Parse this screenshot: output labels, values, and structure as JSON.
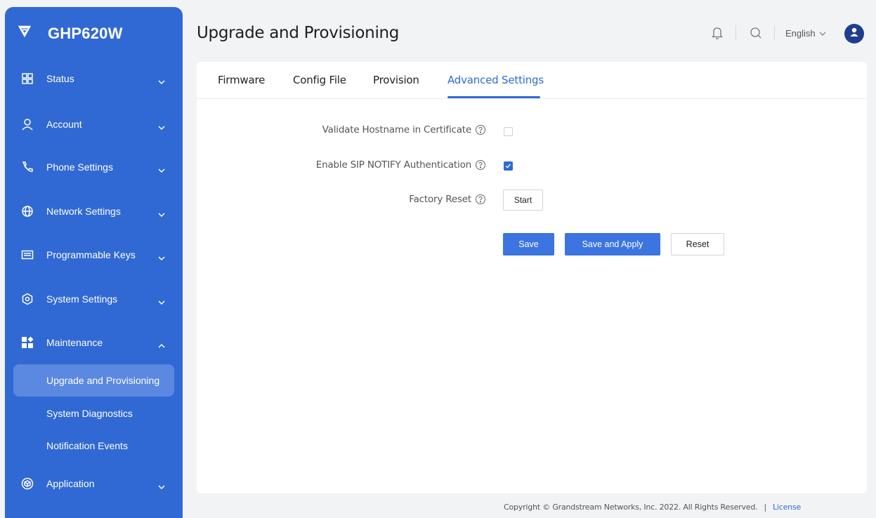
{
  "brand": {
    "name": "GHP620W"
  },
  "sidebar": {
    "items": [
      {
        "label": "Status"
      },
      {
        "label": "Account"
      },
      {
        "label": "Phone Settings"
      },
      {
        "label": "Network Settings"
      },
      {
        "label": "Programmable Keys"
      },
      {
        "label": "System Settings"
      },
      {
        "label": "Maintenance"
      },
      {
        "label": "Application"
      }
    ],
    "sub_items": [
      {
        "label": "Upgrade and Provisioning"
      },
      {
        "label": "System Diagnostics"
      },
      {
        "label": "Notification Events"
      }
    ]
  },
  "header": {
    "title": "Upgrade and Provisioning",
    "language": "English"
  },
  "tabs": [
    {
      "label": "Firmware"
    },
    {
      "label": "Config File"
    },
    {
      "label": "Provision"
    },
    {
      "label": "Advanced Settings"
    }
  ],
  "form": {
    "validate_hostname_label": "Validate Hostname in Certificate",
    "validate_hostname_checked": false,
    "sip_notify_label": "Enable SIP NOTIFY Authentication",
    "sip_notify_checked": true,
    "factory_reset_label": "Factory Reset",
    "start_label": "Start",
    "save_label": "Save",
    "save_apply_label": "Save and Apply",
    "reset_label": "Reset"
  },
  "footer": {
    "copyright": "Copyright © Grandstream Networks, Inc. 2022. All Rights Reserved.",
    "separator": "|",
    "license": "License"
  },
  "colors": {
    "accent": "#3169d4",
    "sidebar_bg": "#3169d4",
    "sidebar_active": "#5b88e0",
    "page_bg": "#f2f3f5"
  }
}
